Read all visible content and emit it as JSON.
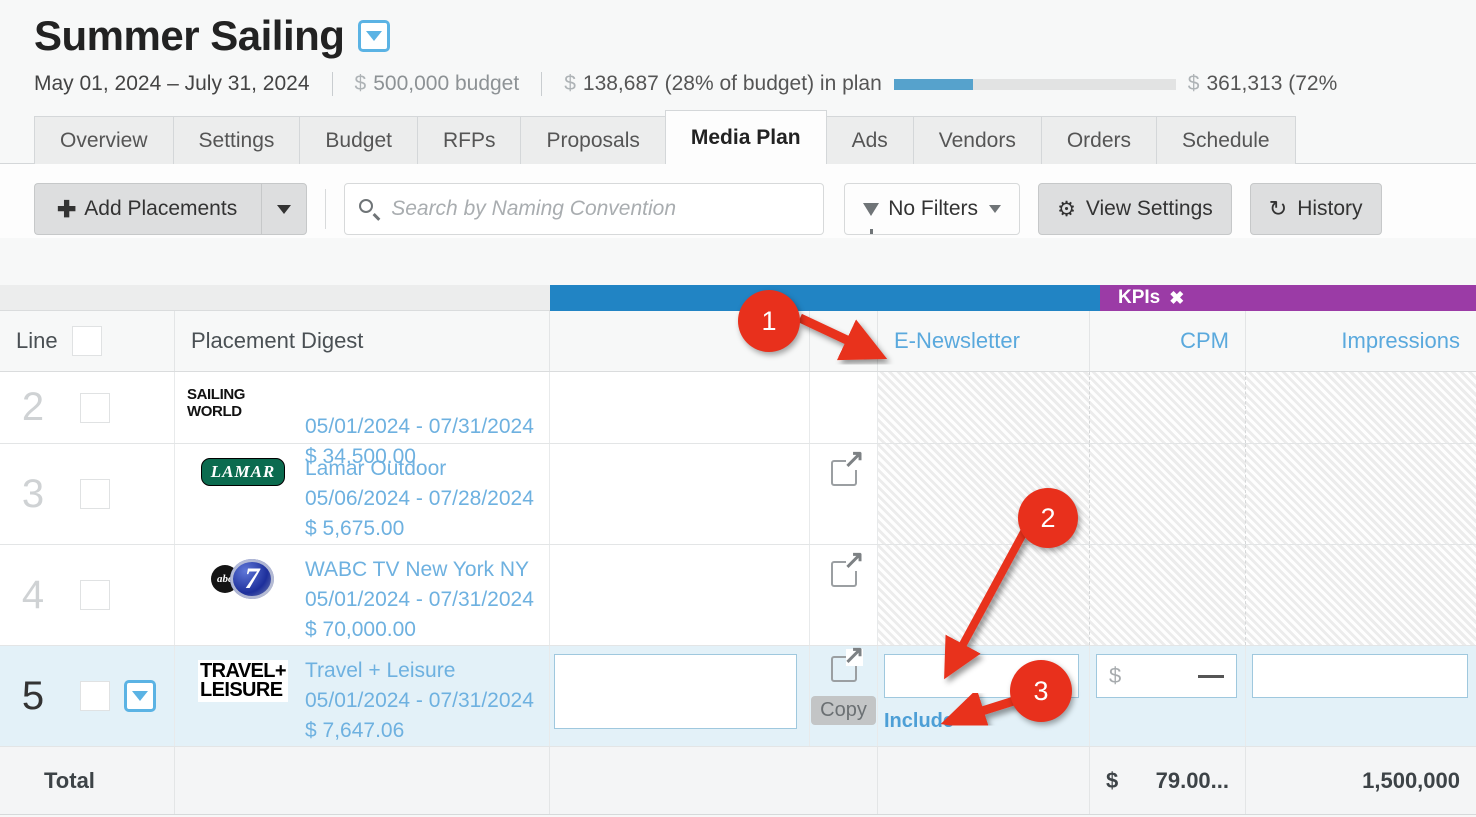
{
  "header": {
    "campaign_title": "Summer Sailing",
    "title_caret_icon": "chevron-down-icon",
    "date_range": "May 01, 2024 – July 31, 2024",
    "budget_currency": "$",
    "budget_total": "500,000 budget",
    "in_plan_currency": "$",
    "in_plan_text": "138,687 (28% of budget) in plan",
    "in_plan_percent": 28,
    "remaining_currency": "$",
    "remaining_text": "361,313 (72%",
    "bar_fill_color": "#56a2cc",
    "bar_track_color": "#e2e3e3"
  },
  "tabs": [
    {
      "label": "Overview",
      "active": false
    },
    {
      "label": "Settings",
      "active": false
    },
    {
      "label": "Budget",
      "active": false
    },
    {
      "label": "RFPs",
      "active": false
    },
    {
      "label": "Proposals",
      "active": false
    },
    {
      "label": "Media Plan",
      "active": true
    },
    {
      "label": "Ads",
      "active": false
    },
    {
      "label": "Vendors",
      "active": false
    },
    {
      "label": "Orders",
      "active": false
    },
    {
      "label": "Schedule",
      "active": false
    }
  ],
  "toolbar": {
    "add_placements_label": "Add Placements",
    "add_plus_icon": "plus-icon",
    "add_caret_icon": "chevron-down-icon",
    "search_icon": "search-icon",
    "search_value": "",
    "search_placeholder": "Search by Naming Convention",
    "filters_icon": "filter-icon",
    "filters_label": "No Filters",
    "filters_caret_icon": "chevron-down-icon",
    "view_settings_icon": "gear-icon",
    "view_settings_label": "View Settings",
    "history_icon": "history-icon",
    "history_label": "History"
  },
  "grid": {
    "band": {
      "blue_color": "#2184c4",
      "kpis_label": "KPIs",
      "kpis_close_icon": "close-icon",
      "purple_color": "#9b3ba6"
    },
    "columns": [
      {
        "key": "line",
        "label": "Line",
        "has_checkbox": true
      },
      {
        "key": "digest",
        "label": "Placement Digest"
      },
      {
        "key": "blank",
        "label": ""
      },
      {
        "key": "copy",
        "label": ""
      },
      {
        "key": "enewsletter",
        "label": "E-Newsletter",
        "link": true
      },
      {
        "key": "cpm",
        "label": "CPM",
        "link": true,
        "align": "right"
      },
      {
        "key": "impressions",
        "label": "Impressions",
        "link": true,
        "align": "right"
      }
    ],
    "rows": [
      {
        "line": "2",
        "selected": false,
        "clipped_top": true,
        "logo": "sailing-world-logo",
        "logo_text": "SAILING WORLD",
        "name": "",
        "dates": "05/01/2024 - 07/31/2024",
        "amount": "$ 34,500.00",
        "ext_link": false,
        "hatched": true
      },
      {
        "line": "3",
        "selected": false,
        "logo": "lamar-logo",
        "logo_text": "LAMAR",
        "name": "Lamar Outdoor",
        "dates": "05/06/2024 - 07/28/2024",
        "amount": "$ 5,675.00",
        "ext_link": true,
        "hatched": true
      },
      {
        "line": "4",
        "selected": false,
        "logo": "abc7-logo",
        "logo_text": "abc 7",
        "name": "WABC TV New York NY",
        "dates": "05/01/2024 - 07/31/2024",
        "amount": "$ 70,000.00",
        "ext_link": true,
        "hatched": true
      },
      {
        "line": "5",
        "selected": true,
        "row_caret_icon": "chevron-down-icon",
        "logo": "travel-leisure-logo",
        "logo_text_1": "TRAVEL+",
        "logo_text_2": "LEISURE",
        "name": "Travel + Leisure",
        "dates": "05/01/2024 - 07/31/2024",
        "amount": "$ 7,647.06",
        "ext_link": true,
        "copy_label": "Copy",
        "include_label": "Include",
        "cpm_currency": "$",
        "cpm_value": "",
        "cpm_dash": "—",
        "impressions_value": "",
        "hatched": false
      }
    ],
    "total": {
      "label": "Total",
      "cpm_currency": "$",
      "cpm_value": "79.00...",
      "impressions_value": "1,500,000"
    }
  },
  "annotations": [
    {
      "number": "1",
      "target": "E-Newsletter column header"
    },
    {
      "number": "2",
      "target": "E-Newsletter input cell row 5"
    },
    {
      "number": "3",
      "target": "Include link row 5"
    }
  ]
}
